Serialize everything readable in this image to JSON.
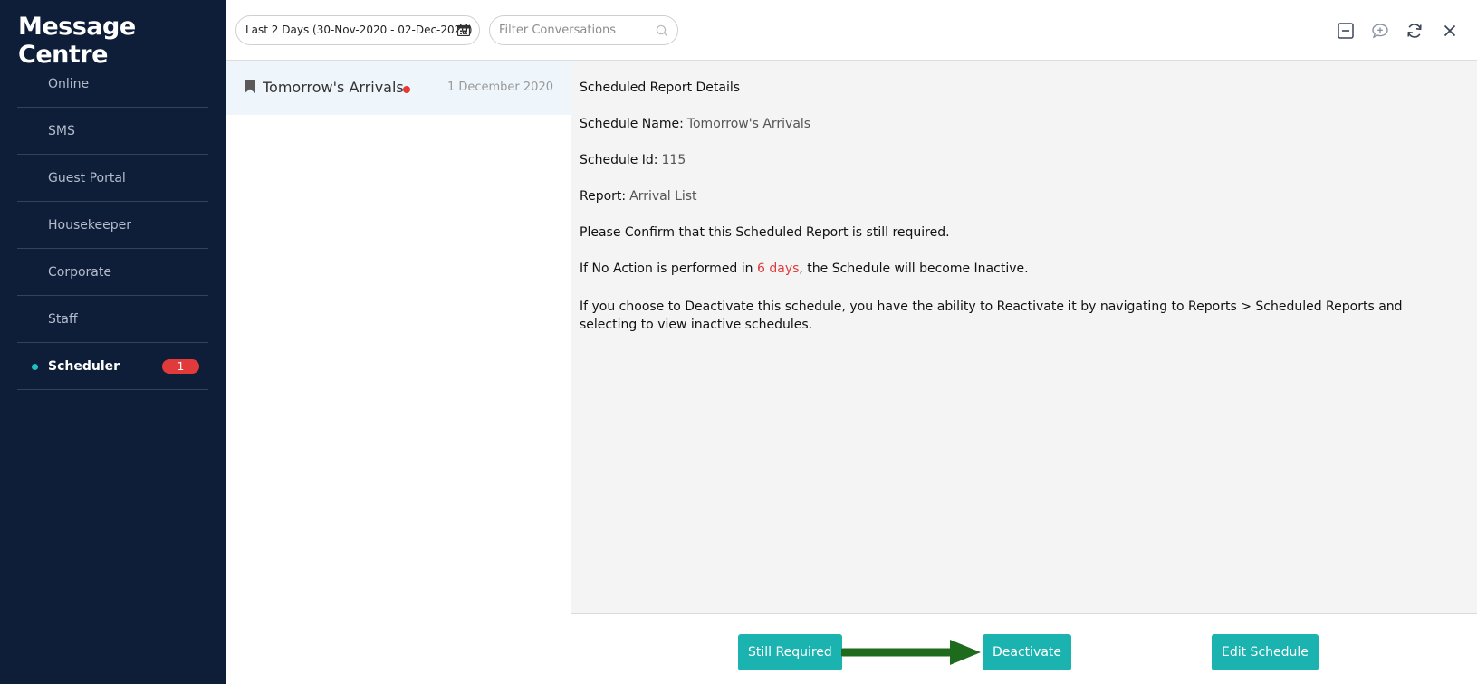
{
  "app": {
    "title": "Message Centre"
  },
  "sidebar": {
    "items": [
      {
        "label": "Online"
      },
      {
        "label": "SMS"
      },
      {
        "label": "Guest Portal"
      },
      {
        "label": "Housekeeper"
      },
      {
        "label": "Corporate"
      },
      {
        "label": "Staff"
      },
      {
        "label": "Scheduler",
        "badge": "1",
        "active": true
      }
    ]
  },
  "toolbar": {
    "date_range": "Last 2 Days (30-Nov-2020 - 02-Dec-2020)",
    "search_placeholder": "Filter Conversations",
    "icons": [
      "minimize-icon",
      "new-message-icon",
      "refresh-icon",
      "close-icon"
    ]
  },
  "conversation": {
    "name": "Tomorrow's Arrivals",
    "date": "1 December 2020",
    "unread": true
  },
  "detail": {
    "heading": "Scheduled Report Details",
    "schedule_name_label": "Schedule Name:",
    "schedule_name": "Tomorrow's Arrivals",
    "schedule_id_label": "Schedule Id:",
    "schedule_id": "115",
    "report_label": "Report:",
    "report": "Arrival List",
    "confirm_text": "Please Confirm that this Scheduled Report is still required.",
    "no_action_prefix": "If No Action is performed in ",
    "no_action_days": "6 days",
    "no_action_suffix": ", the Schedule will become Inactive.",
    "deactivate_info": "If you choose to Deactivate this schedule, you have the ability to Reactivate it by navigating to Reports > Scheduled Reports and selecting to view inactive schedules."
  },
  "footer": {
    "still_required": "Still Required",
    "deactivate": "Deactivate",
    "edit_schedule": "Edit Schedule"
  },
  "colors": {
    "sidebar_bg": "#0f1e38",
    "accent": "#1ab3b0",
    "badge": "#e03a3a",
    "annotation_arrow": "#1e6b1e"
  }
}
